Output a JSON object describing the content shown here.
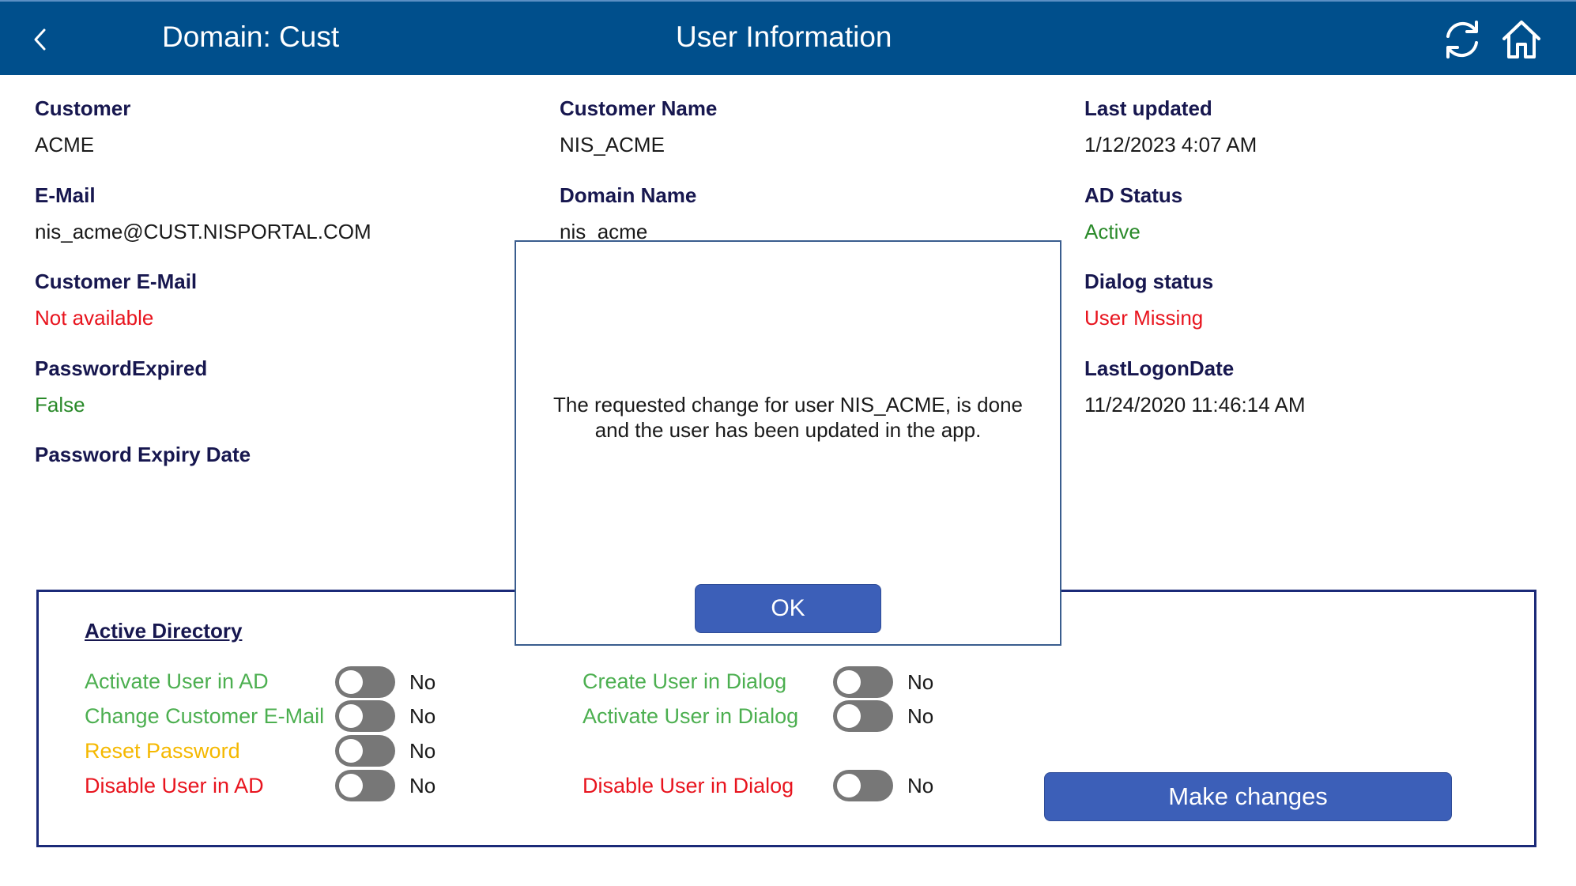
{
  "header": {
    "domain": "Domain: Cust",
    "title": "User Information",
    "icons": {
      "back": "chevron-left-icon",
      "refresh": "refresh-icon",
      "home": "home-icon"
    }
  },
  "fields": {
    "customer": {
      "label": "Customer",
      "value": "ACME"
    },
    "customer_name": {
      "label": "Customer Name",
      "value": "NIS_ACME"
    },
    "last_updated": {
      "label": "Last updated",
      "value": "1/12/2023 4:07 AM"
    },
    "email": {
      "label": "E-Mail",
      "value": "nis_acme@CUST.NISPORTAL.COM"
    },
    "domain_name": {
      "label": "Domain Name",
      "value": "nis_acme"
    },
    "ad_status": {
      "label": "AD Status",
      "value": "Active"
    },
    "customer_email": {
      "label": "Customer E-Mail",
      "value": "Not available"
    },
    "dialog_status": {
      "label": "Dialog status",
      "value": "User Missing"
    },
    "password_expired": {
      "label": "PasswordExpired",
      "value": "False"
    },
    "last_logon_date": {
      "label": "LastLogonDate",
      "value": "11/24/2020 11:46:14 AM"
    },
    "password_expiry_date": {
      "label": "Password Expiry Date",
      "value": ""
    }
  },
  "active_directory": {
    "title": "Active Directory",
    "toggles_left": [
      {
        "label": "Activate User in AD",
        "state": "No",
        "color": "#4caf50"
      },
      {
        "label": "Change Customer E-Mail",
        "state": "No",
        "color": "#4caf50"
      },
      {
        "label": "Reset Password",
        "state": "No",
        "color": "#f5b800"
      },
      {
        "label": "Disable User in AD",
        "state": "No",
        "color": "#e8141e"
      }
    ],
    "toggles_right": [
      {
        "label": "Create User in Dialog",
        "state": "No",
        "color": "#4caf50"
      },
      {
        "label": "Activate User in Dialog",
        "state": "No",
        "color": "#4caf50"
      },
      {
        "label": "Disable User in Dialog",
        "state": "No",
        "color": "#e8141e"
      }
    ],
    "make_changes_label": "Make changes"
  },
  "dialog": {
    "message": "The requested change for user NIS_ACME, is done and the user has been updated in the app.",
    "ok_label": "OK"
  },
  "colors": {
    "header_bg": "#004f8c",
    "label_navy": "#17174f",
    "button_blue": "#3c5fb8",
    "status_green": "#2a8a2a",
    "status_red": "#e8141e"
  }
}
